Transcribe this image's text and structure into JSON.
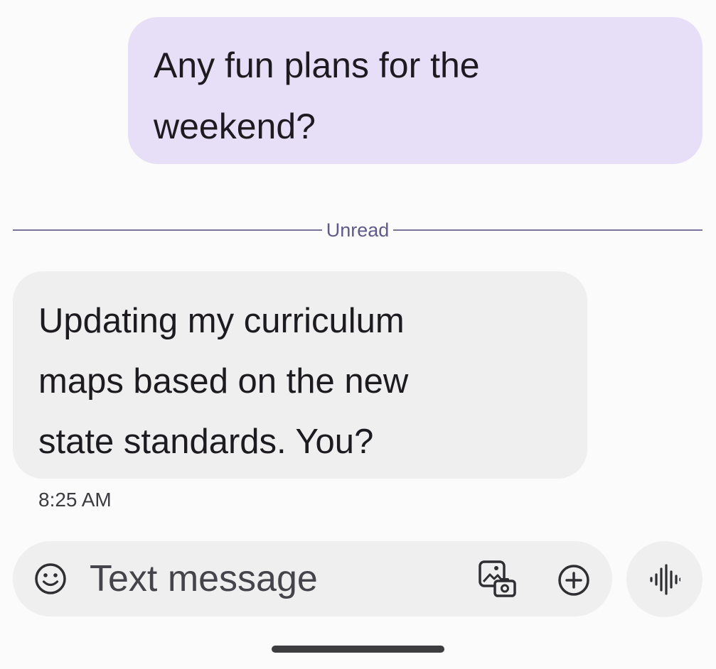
{
  "conversation": {
    "outgoing_message": {
      "lines": [
        "Any fun plans for the",
        "weekend?"
      ]
    },
    "divider_label": "Unread",
    "incoming_message": {
      "lines": [
        "Updating my curriculum",
        "maps based on the new",
        "state standards. You?"
      ],
      "timestamp": "8:25 AM"
    }
  },
  "composer": {
    "placeholder": "Text message",
    "icons": {
      "emoji": "emoji-icon",
      "gallery": "gallery-icon",
      "add": "add-icon",
      "voice": "voice-icon"
    }
  },
  "colors": {
    "outgoing_bubble": "#e6dff7",
    "incoming_bubble": "#efefef",
    "divider": "#5f5a8a"
  }
}
